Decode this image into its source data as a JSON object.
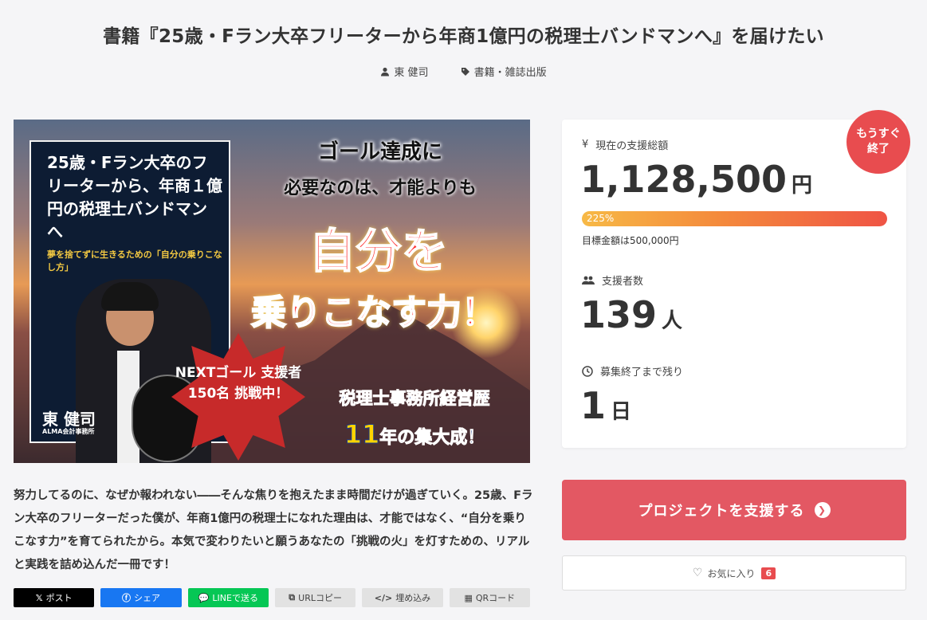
{
  "project": {
    "title": "書籍『25歳・Fラン大卒フリーターから年商1億円の税理士バンドマンへ』を届けたい",
    "author": "東 健司",
    "category": "書籍・雑誌出版"
  },
  "hero": {
    "book_title": "25歳・Fラン大卒のフリーターから、年商１億円の税理士バンドマンへ",
    "book_subtitle": "夢を捨てずに生きるための「自分の乗りこなし方」",
    "author_name": "東 健司",
    "author_company": "ALMA会計事務所",
    "catch_line1": "ゴール達成に",
    "catch_line2": "必要なのは、才能よりも",
    "big_line1": "自分を",
    "big_line2": "乗りこなす力！",
    "star_text": "NEXTゴール 支援者150名 挑戦中！",
    "band_line1": "税理士事務所経営歴",
    "band_number": "11",
    "band_line2_suffix": "年の集大成！"
  },
  "description": "努力してるのに、なぜか報われない――そんな焦りを抱えたまま時間だけが過ぎていく。25歳、Fラン大卒のフリーターだった僕が、年商1億円の税理士になれた理由は、才能ではなく、“自分を乗りこなす力”を育てられたから。本気で変わりたいと願うあなたの「挑戦の火」を灯すための、リアルと実践を詰め込んだ一冊です！",
  "share": {
    "post": "ポスト",
    "share": "シェア",
    "line": "LINEで送る",
    "url_copy": "URLコピー",
    "embed": "埋め込み",
    "qr": "QRコード"
  },
  "stats": {
    "badge": "もうすぐ終了",
    "raised_label": "現在の支援総額",
    "raised_value": "1,128,500",
    "raised_unit": "円",
    "progress_percent": 225,
    "progress_label": "225%",
    "goal_text": "目標金額は500,000円",
    "backers_label": "支援者数",
    "backers_value": "139",
    "backers_unit": "人",
    "remaining_label": "募集終了まで残り",
    "remaining_value": "1",
    "remaining_unit": "日"
  },
  "actions": {
    "support_label": "プロジェクトを支援する",
    "favorite_label": "お気に入り",
    "favorite_count": "6"
  },
  "colors": {
    "accent": "#e35863",
    "badge": "#e84c4f"
  }
}
